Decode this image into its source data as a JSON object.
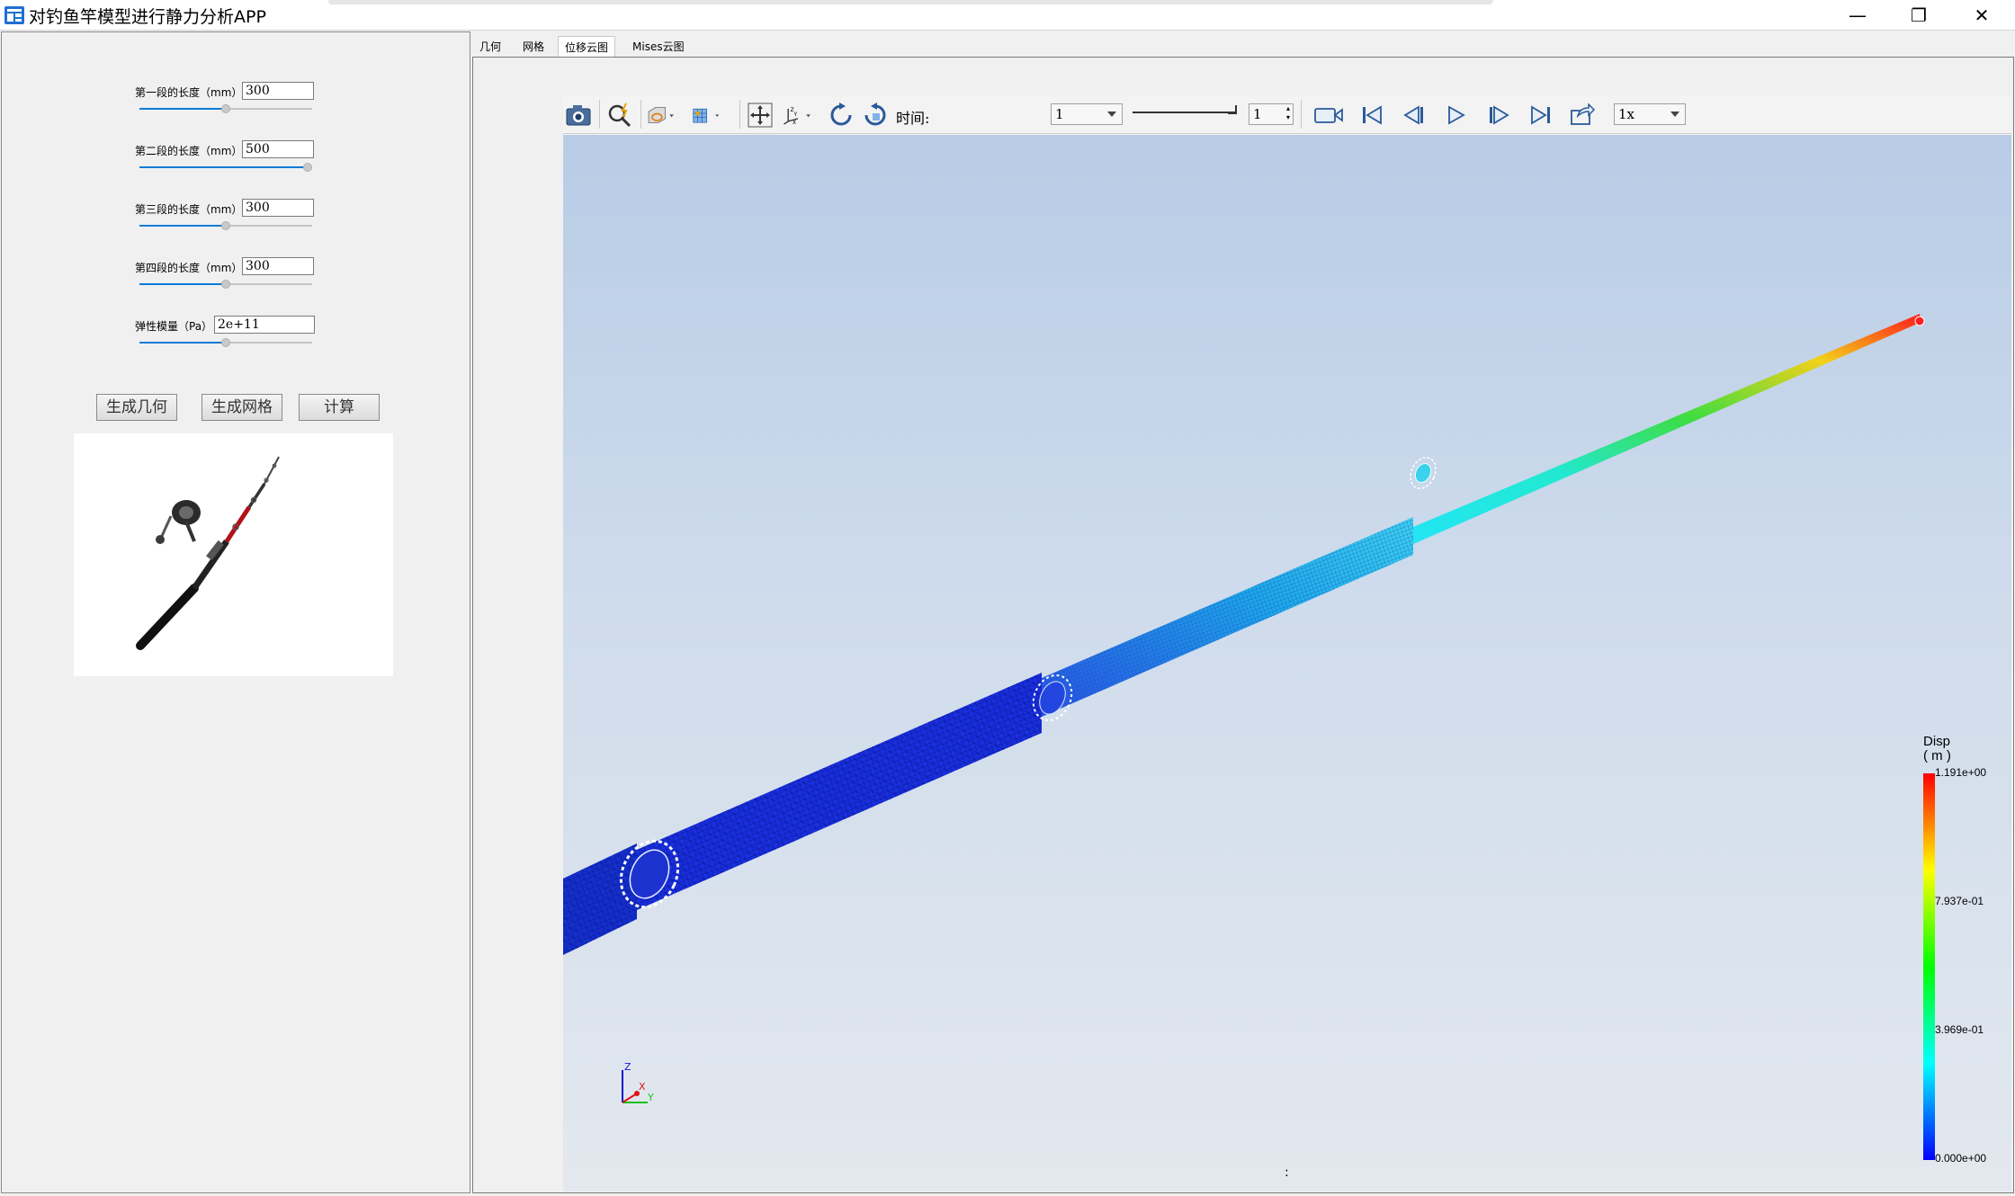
{
  "window": {
    "title": "对钓鱼竿模型进行静力分析APP",
    "minimize_glyph": "—",
    "restore_glyph": "❐",
    "close_glyph": "✕"
  },
  "params": [
    {
      "label": "第一段的长度（mm）",
      "value": "300",
      "slider_fraction": 0.5
    },
    {
      "label": "第二段的长度（mm）",
      "value": "500",
      "slider_fraction": 1.0
    },
    {
      "label": "第三段的长度（mm）",
      "value": "300",
      "slider_fraction": 0.5
    },
    {
      "label": "第四段的长度（mm）",
      "value": "300",
      "slider_fraction": 0.5
    },
    {
      "label": "弹性模量（Pa）",
      "value": "2e+11",
      "slider_fraction": 0.5
    }
  ],
  "buttons": {
    "generate_geometry": "生成几何",
    "generate_mesh": "生成网格",
    "compute": "计算"
  },
  "tabs": [
    {
      "label": "几何",
      "active": false
    },
    {
      "label": "网格",
      "active": false
    },
    {
      "label": "位移云图",
      "active": true
    },
    {
      "label": "Mises云图",
      "active": false
    }
  ],
  "toolbar": {
    "icons": [
      "camera-icon",
      "zoom-fit-icon",
      "clip-plane-icon",
      "display-mode-icon",
      "pan-icon",
      "axes-icon",
      "rotate-cw-icon",
      "rotate-ccw-icon",
      "record-icon",
      "first-frame-icon",
      "prev-frame-icon",
      "play-icon",
      "next-frame-icon",
      "last-frame-icon",
      "export-icon"
    ],
    "time_label": "时间:",
    "time_value": "1",
    "frame_value": "1",
    "speed_value": "1x"
  },
  "legend": {
    "title": "Disp",
    "unit": "( m )",
    "ticks": [
      "1.191e+00",
      "7.937e-01",
      "3.969e-01",
      "0.000e+00"
    ],
    "colors": [
      "#ff0000",
      "#ffff00",
      "#00ff00",
      "#00ffff",
      "#0000ff"
    ]
  },
  "axes_triad": {
    "z": "Z",
    "x": "X",
    "y": "Y"
  },
  "status_glyph": ":"
}
